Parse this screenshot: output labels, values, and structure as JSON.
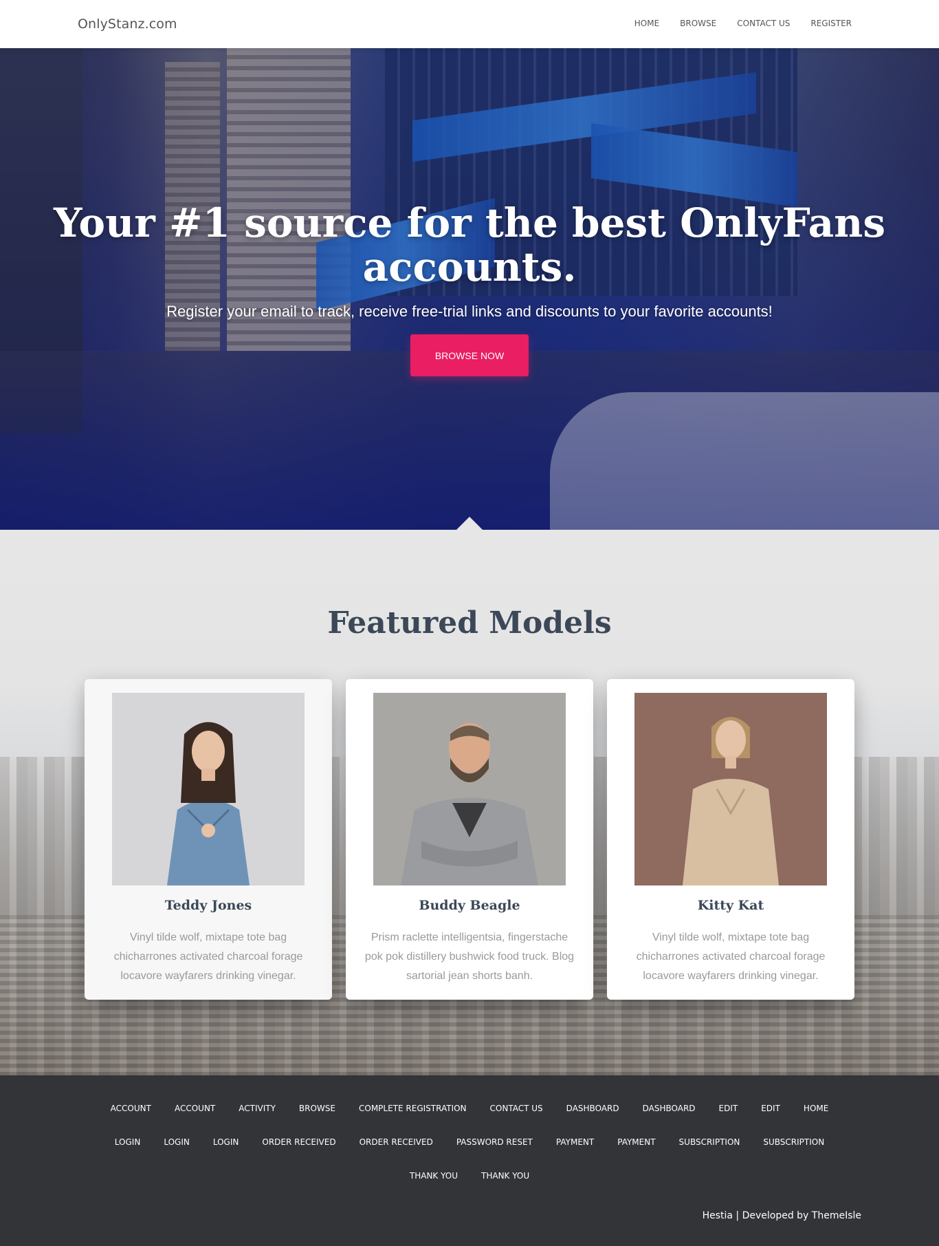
{
  "site": {
    "brand": "OnlyStanz.com"
  },
  "nav": [
    {
      "label": "HOME"
    },
    {
      "label": "BROWSE"
    },
    {
      "label": "CONTACT US"
    },
    {
      "label": "REGISTER"
    }
  ],
  "hero": {
    "title": "Your #1 source for the best OnlyFans accounts.",
    "subtitle": "Register your email to track, receive free-trial links and discounts to your favorite accounts!",
    "cta_label": "BROWSE NOW",
    "accent": "#e91e63"
  },
  "featured": {
    "title": "Featured Models",
    "cards": [
      {
        "name": "Teddy Jones",
        "desc": "Vinyl tilde wolf, mixtape tote bag chicharrones activated charcoal forage locavore wayfarers drinking vinegar."
      },
      {
        "name": "Buddy Beagle",
        "desc": "Prism raclette intelligentsia, fingerstache pok pok distillery bushwick food truck. Blog sartorial jean shorts banh."
      },
      {
        "name": "Kitty Kat",
        "desc": "Vinyl tilde wolf, mixtape tote bag chicharrones activated charcoal forage locavore wayfarers drinking vinegar."
      }
    ]
  },
  "footer": {
    "links": [
      "ACCOUNT",
      "ACCOUNT",
      "ACTIVITY",
      "BROWSE",
      "COMPLETE REGISTRATION",
      "CONTACT US",
      "DASHBOARD",
      "DASHBOARD",
      "EDIT",
      "EDIT",
      "HOME",
      "LOGIN",
      "LOGIN",
      "LOGIN",
      "ORDER RECEIVED",
      "ORDER RECEIVED",
      "PASSWORD RESET",
      "PAYMENT",
      "PAYMENT",
      "SUBSCRIPTION",
      "SUBSCRIPTION",
      "THANK YOU",
      "THANK YOU"
    ],
    "credit": "Hestia | Developed by ThemeIsle"
  }
}
